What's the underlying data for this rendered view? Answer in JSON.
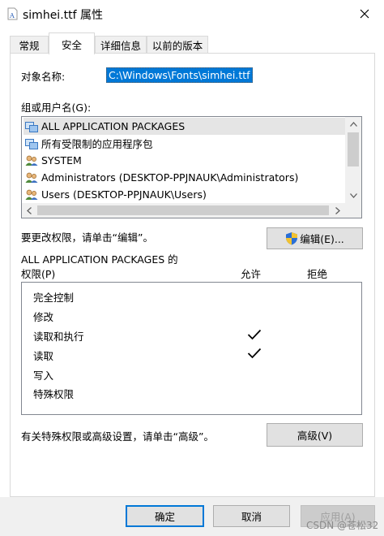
{
  "window": {
    "title": "simhei.ttf 属性"
  },
  "tabs": [
    {
      "label": "常规",
      "active": false
    },
    {
      "label": "安全",
      "active": true
    },
    {
      "label": "详细信息",
      "active": false
    },
    {
      "label": "以前的版本",
      "active": false
    }
  ],
  "security": {
    "object_label": "对象名称:",
    "object_value": "C:\\Windows\\Fonts\\simhei.ttf",
    "groups_label": "组或用户名(G):",
    "users": [
      {
        "name": "ALL APPLICATION PACKAGES",
        "icon": "app-packages-icon",
        "selected": true
      },
      {
        "name": "所有受限制的应用程序包",
        "icon": "app-packages-icon",
        "selected": false
      },
      {
        "name": "SYSTEM",
        "icon": "users-group-icon",
        "selected": false
      },
      {
        "name": "Administrators (DESKTOP-PPJNAUK\\Administrators)",
        "icon": "users-group-icon",
        "selected": false
      },
      {
        "name": "Users (DESKTOP-PPJNAUK\\Users)",
        "icon": "users-group-icon",
        "selected": false
      }
    ],
    "change_hint": "要更改权限，请单击“编辑”。",
    "edit_button": "编辑(E)...",
    "permissions_for": "ALL APPLICATION PACKAGES 的",
    "permissions_label": "权限(P)",
    "allow_header": "允许",
    "deny_header": "拒绝",
    "permissions": [
      {
        "name": "完全控制",
        "allow": false,
        "deny": false
      },
      {
        "name": "修改",
        "allow": false,
        "deny": false
      },
      {
        "name": "读取和执行",
        "allow": true,
        "deny": false
      },
      {
        "name": "读取",
        "allow": true,
        "deny": false
      },
      {
        "name": "写入",
        "allow": false,
        "deny": false
      },
      {
        "name": "特殊权限",
        "allow": false,
        "deny": false
      }
    ],
    "advanced_hint": "有关特殊权限或高级设置，请单击“高级”。",
    "advanced_button": "高级(V)"
  },
  "footer": {
    "ok": "确定",
    "cancel": "取消",
    "apply": "应用(A)",
    "watermark": "CSDN @苍松32"
  },
  "colors": {
    "selection": "#0078d7",
    "shield_blue": "#2a6fd6",
    "shield_yellow": "#f2c230"
  }
}
